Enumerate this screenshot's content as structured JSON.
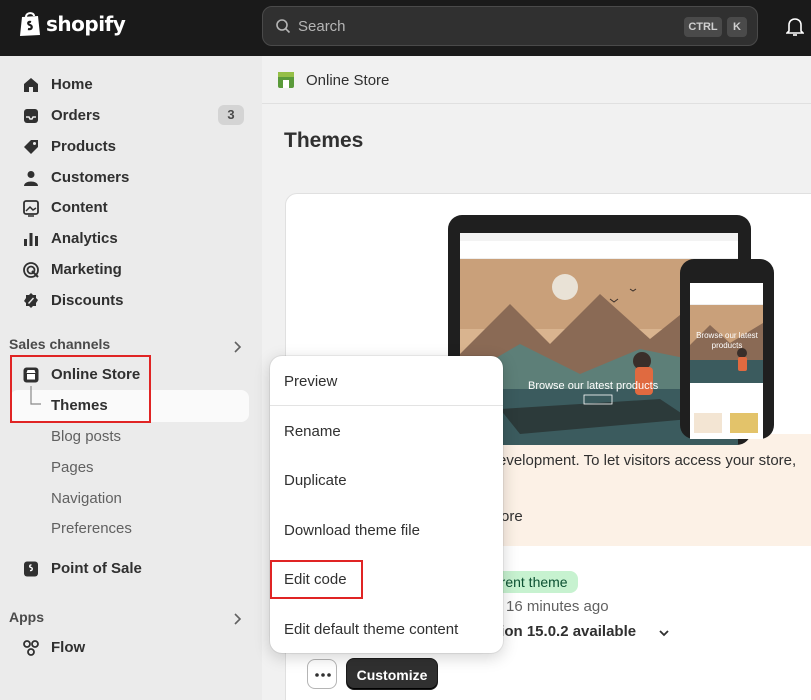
{
  "topbar": {
    "brand": "shopify",
    "search_placeholder": "Search",
    "shortcut_ctrl": "CTRL",
    "shortcut_k": "K"
  },
  "sidebar": {
    "items": [
      {
        "label": "Home",
        "icon": "home-icon"
      },
      {
        "label": "Orders",
        "icon": "inbox-icon",
        "badge": "3"
      },
      {
        "label": "Products",
        "icon": "tag-icon"
      },
      {
        "label": "Customers",
        "icon": "person-icon"
      },
      {
        "label": "Content",
        "icon": "image-icon"
      },
      {
        "label": "Analytics",
        "icon": "bar-chart-icon"
      },
      {
        "label": "Marketing",
        "icon": "target-icon"
      },
      {
        "label": "Discounts",
        "icon": "discount-icon"
      }
    ],
    "sales_channels_label": "Sales channels",
    "online_store_label": "Online Store",
    "themes_label": "Themes",
    "sub_items": [
      "Blog posts",
      "Pages",
      "Navigation",
      "Preferences"
    ],
    "pos_label": "Point of Sale",
    "apps_label": "Apps",
    "flow_label": "Flow"
  },
  "header": {
    "store_title": "Online Store"
  },
  "main": {
    "page_title": "Themes",
    "banner_text": "evelopment. To let visitors access your store,",
    "learn_more": "n more",
    "current_theme_badge": "rrent theme",
    "saved_time": "16 minutes ago",
    "version_text": "rsion 15.0.2 available",
    "customize_label": "Customize",
    "preview_hero_text": "Browse our latest products",
    "phone_hero_text": "Browse our latest products"
  },
  "menu": {
    "items": [
      "Preview",
      "Rename",
      "Duplicate",
      "Download theme file",
      "Edit code",
      "Edit default theme content"
    ]
  },
  "colors": {
    "highlight_red": "#e02424",
    "topbar": "#1a1a1a",
    "banner": "#fcf1e6",
    "success_badge": "#c7f2d0"
  }
}
